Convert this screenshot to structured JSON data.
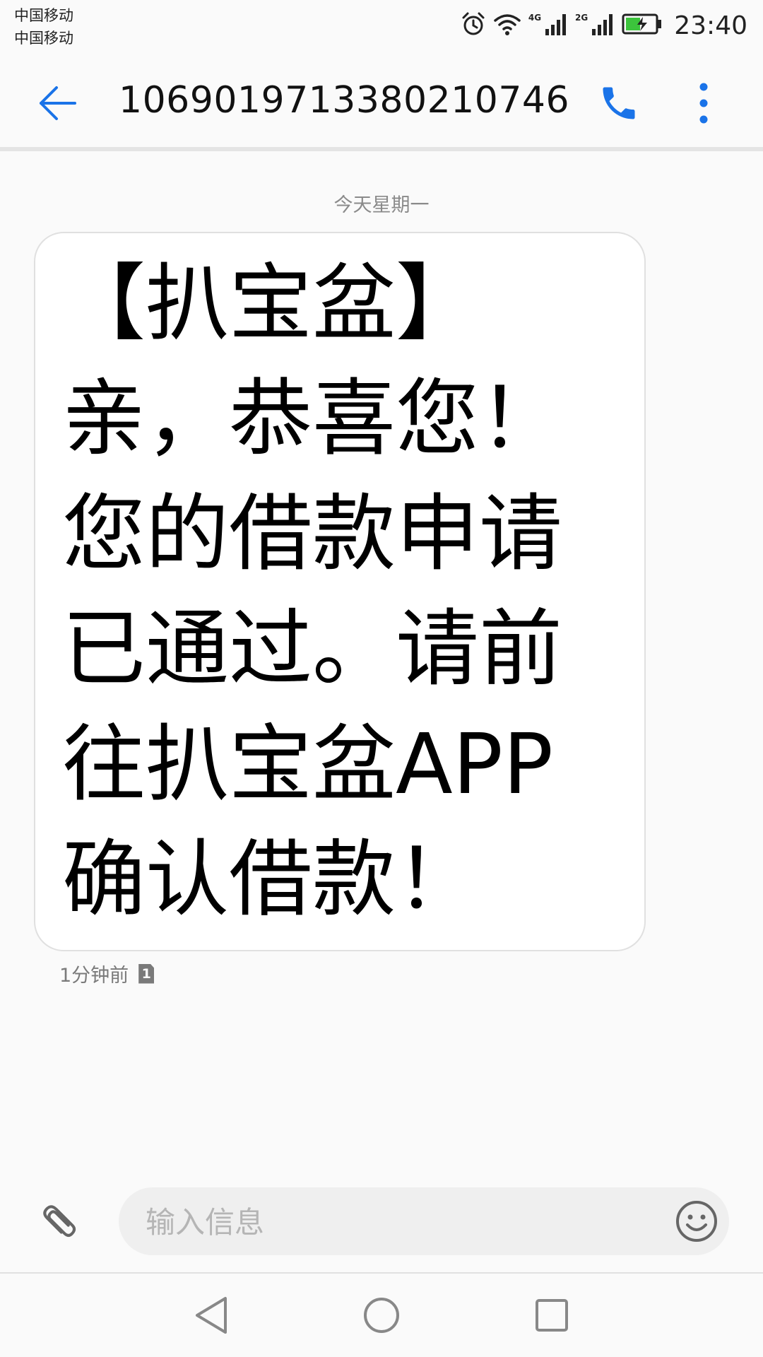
{
  "status_bar": {
    "carrier_1": "中国移动",
    "carrier_2": "中国移动",
    "network_1": "4G",
    "network_2": "2G",
    "time": "23:40",
    "icons": [
      "alarm-icon",
      "wifi-icon",
      "signal-icon",
      "signal-icon",
      "battery-charging-icon"
    ],
    "battery_color": "#3cc43c"
  },
  "header": {
    "title": "1069019713380210746",
    "back_icon": "back-arrow-icon",
    "call_icon": "phone-icon",
    "menu_icon": "more-vert-icon",
    "accent_color": "#1a73e8"
  },
  "conversation": {
    "date_label": "今天星期一",
    "messages": [
      {
        "text": "【扒宝盆】亲，恭喜您！您的借款申请已通过。请前往扒宝盆APP确认借款！",
        "time": "1分钟前",
        "sim": "1"
      }
    ]
  },
  "compose": {
    "placeholder": "输入信息",
    "value": "",
    "attach_icon": "paperclip-icon",
    "emoji_icon": "emoji-icon"
  },
  "nav_bar": {
    "icons": [
      "nav-back-icon",
      "nav-home-icon",
      "nav-recents-icon"
    ]
  }
}
